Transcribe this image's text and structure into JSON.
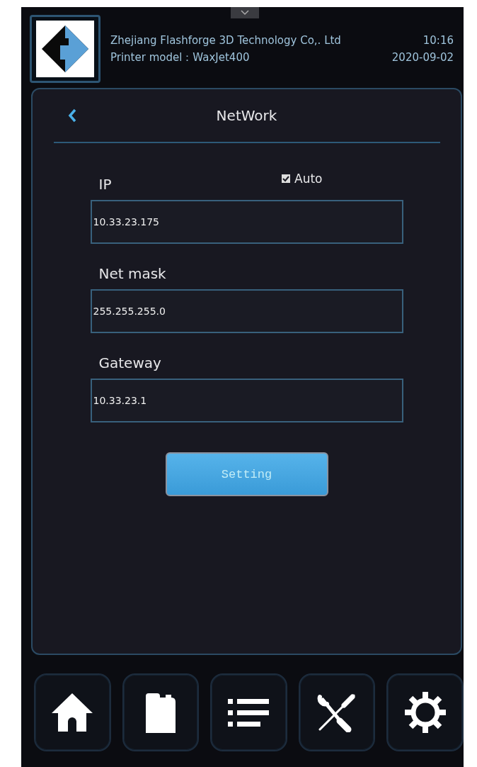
{
  "header": {
    "company": "Zhejiang Flashforge 3D Technology Co,. Ltd",
    "model": "Printer model：WaxJet400",
    "time": "10:16",
    "date": "2020-09-02"
  },
  "page": {
    "title": "NetWork"
  },
  "auto": {
    "label": "Auto",
    "checked": true
  },
  "fields": [
    {
      "label": "IP",
      "value": "10.33.23.175"
    },
    {
      "label": "Net mask",
      "value": "255.255.255.0"
    },
    {
      "label": "Gateway",
      "value": "10.33.23.1"
    }
  ],
  "button": "Setting",
  "nav": [
    {
      "kind": "home"
    },
    {
      "kind": "bottle"
    },
    {
      "kind": "list"
    },
    {
      "kind": "tools"
    },
    {
      "kind": "gear"
    }
  ]
}
